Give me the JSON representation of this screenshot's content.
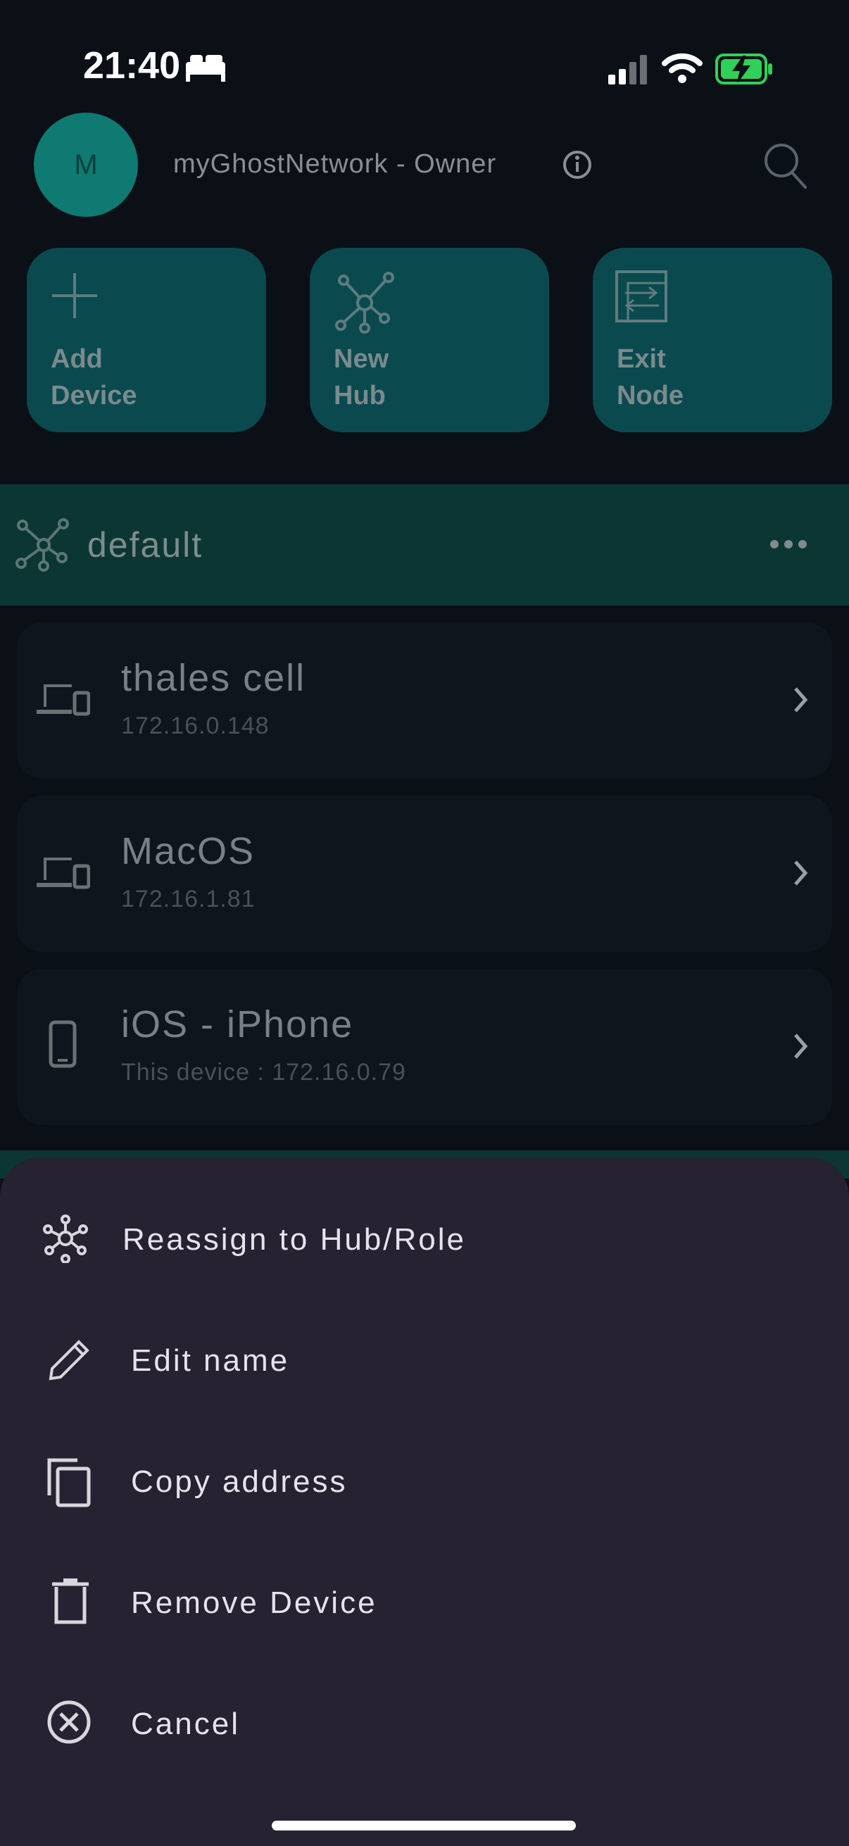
{
  "status": {
    "time": "21:40"
  },
  "header": {
    "avatar_initial": "M",
    "network_title": "myGhostNetwork - Owner"
  },
  "actions": [
    {
      "label": "Add\nDevice",
      "icon": "plus-icon"
    },
    {
      "label": "New\nHub",
      "icon": "hub-icon"
    },
    {
      "label": "Exit\nNode",
      "icon": "exit-node-icon"
    }
  ],
  "hub": {
    "name": "default"
  },
  "devices": [
    {
      "name": "thales cell",
      "sub": "172.16.0.148",
      "icon": "devices-icon"
    },
    {
      "name": "MacOS",
      "sub": "172.16.1.81",
      "icon": "devices-icon"
    },
    {
      "name": "iOS - iPhone",
      "sub": "This device : 172.16.0.79",
      "icon": "phone-icon"
    }
  ],
  "menu": [
    {
      "label": "Reassign to Hub/Role",
      "icon": "hub-network-icon"
    },
    {
      "label": "Edit name",
      "icon": "pencil-icon"
    },
    {
      "label": "Copy address",
      "icon": "copy-icon"
    },
    {
      "label": "Remove Device",
      "icon": "trash-icon"
    },
    {
      "label": "Cancel",
      "icon": "cancel-icon"
    }
  ]
}
